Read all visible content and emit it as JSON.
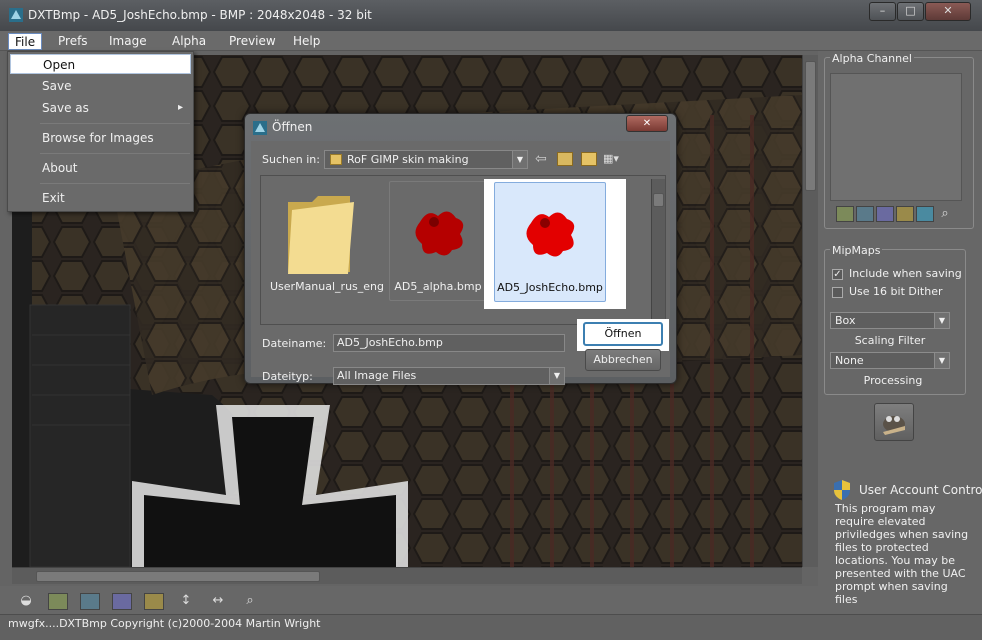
{
  "window": {
    "app_name": "DXTBmp",
    "title": "DXTBmp - AD5_JoshEcho.bmp - BMP : 2048x2048 - 32 bit",
    "controls": {
      "minimize": "–",
      "maximize": "□",
      "close": "✕"
    }
  },
  "menubar": {
    "items": [
      {
        "label": "File"
      },
      {
        "label": "Prefs"
      },
      {
        "label": "Image"
      },
      {
        "label": "Alpha"
      },
      {
        "label": "Preview"
      },
      {
        "label": "Help"
      }
    ]
  },
  "file_menu": {
    "items": [
      {
        "label": "Open"
      },
      {
        "label": "Save"
      },
      {
        "label": "Save as",
        "submenu_arrow": "▸"
      },
      {
        "label": "Browse for Images"
      },
      {
        "label": "About"
      },
      {
        "label": "Exit"
      }
    ]
  },
  "dialog": {
    "title": "Öffnen",
    "look_in_label": "Suchen in:",
    "look_in_value": "RoF GIMP skin making",
    "files": [
      {
        "name": "UserManual_rus_eng",
        "type": "folder",
        "selected": false
      },
      {
        "name": "AD5_alpha.bmp",
        "type": "image",
        "selected": false
      },
      {
        "name": "AD5_JoshEcho.bmp",
        "type": "image",
        "selected": true
      }
    ],
    "filename_label": "Dateiname:",
    "filename_value": "AD5_JoshEcho.bmp",
    "filetype_label": "Dateityp:",
    "filetype_value": "All Image Files",
    "open_button": "Öffnen",
    "cancel_button": "Abbrechen"
  },
  "right_panel": {
    "alpha_channel_label": "Alpha Channel",
    "mipmaps_label": "MipMaps",
    "include_when_saving": {
      "label": "Include when saving",
      "checked": true
    },
    "use_16bit_dither": {
      "label": "Use 16 bit Dither",
      "checked": false
    },
    "scaling_filter_value": "Box",
    "scaling_filter_label": "Scaling Filter",
    "processing_value": "None",
    "processing_label": "Processing",
    "uac_title": "User Account Control",
    "uac_text": "This program may require elevated priviledges when saving files to protected locations. You may be presented with the UAC prompt when saving files"
  },
  "statusbar": {
    "text": "mwgfx....DXTBmp Copyright (c)2000-2004 Martin Wright"
  },
  "colors": {
    "selection_blue": "#d9e8fb",
    "primary_button_border": "#3c7fb1",
    "puzzle_red": "#d40000"
  },
  "icons": {
    "bottom_toolbar": [
      "alpha-mask-icon",
      "open-folder-icon",
      "import-icon",
      "export-icon",
      "folder-image-icon",
      "flip-vertical-icon",
      "flip-horizontal-icon",
      "zoom-icon"
    ],
    "alpha_toolbar": [
      "open-folder-icon",
      "import-icon",
      "export-icon",
      "folder-icon",
      "image-icon",
      "zoom-icon"
    ]
  }
}
